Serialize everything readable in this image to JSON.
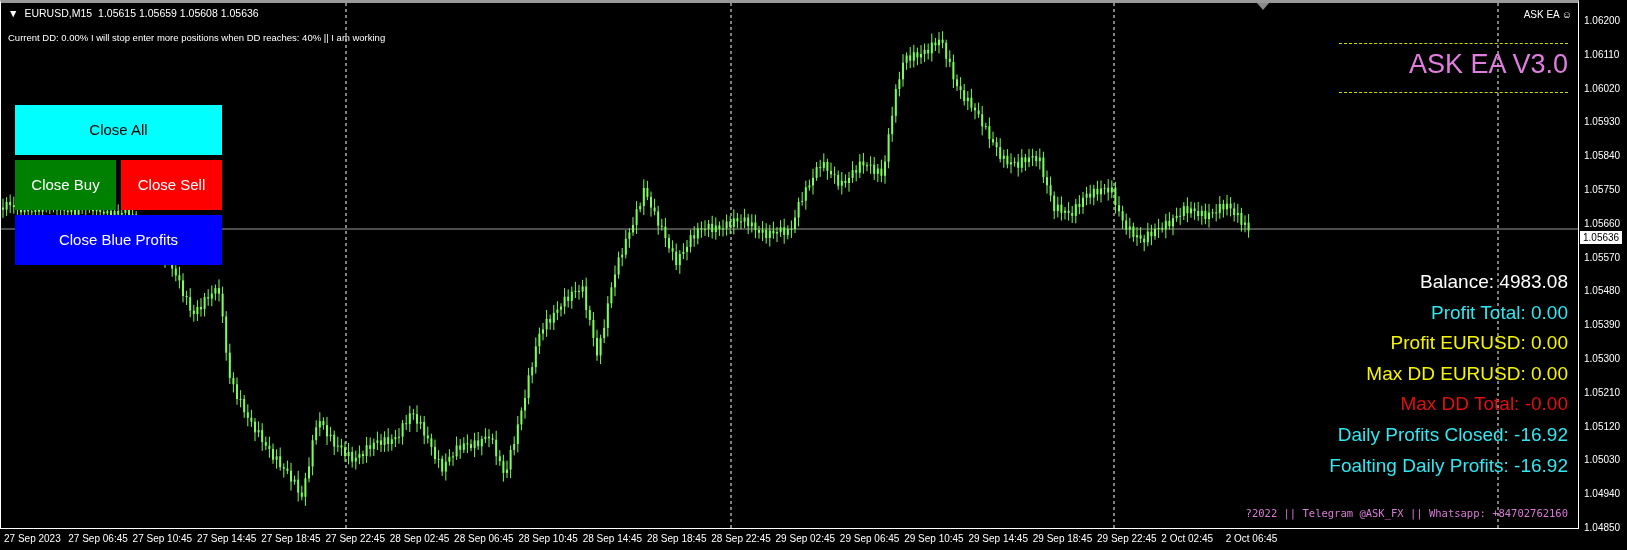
{
  "chart_header": {
    "menu_icon": "▼",
    "title": "EURUSD,M15",
    "ohlc": "1.05615 1.05659 1.05608 1.05636"
  },
  "status_line": "Current DD: 0.00%  I will stop enter more positions when DD reaches: 40%  || I am working",
  "ea_badge": {
    "name": "ASK EA",
    "icon": "☺"
  },
  "ea_title": "ASK EA V3.0",
  "button_rows": [
    [
      {
        "label": "Close All",
        "color": "#00ffff"
      }
    ],
    [
      {
        "label": "Close Buy",
        "color": "#008000"
      },
      {
        "label": "Close Sell",
        "color": "#ff0000"
      }
    ],
    [
      {
        "label": "Close Blue Profits",
        "color": "#0000ff"
      }
    ]
  ],
  "stats": [
    {
      "text": "Balance: 4983.08",
      "color": "#ffffff"
    },
    {
      "text": "Profit Total: 0.00",
      "color": "#33e6f0"
    },
    {
      "text": "Profit EURUSD: 0.00",
      "color": "#f5f500"
    },
    {
      "text": "Max DD EURUSD: 0.00",
      "color": "#f5f500"
    },
    {
      "text": "Max DD Total: -0.00",
      "color": "#e01010"
    },
    {
      "text": "Daily Profits Closed: -16.92",
      "color": "#33e6f0"
    },
    {
      "text": "Foalting Daily Profits: -16.92",
      "color": "#33e6f0"
    }
  ],
  "footer": "?2022 || Telegram @ASK_FX || Whatsapp: +84702762160",
  "price_axis": {
    "labels": [
      "1.06200",
      "1.06110",
      "1.06020",
      "1.05930",
      "1.05840",
      "1.05750",
      "1.05660",
      "1.05570",
      "1.05480",
      "1.05390",
      "1.05300",
      "1.05210",
      "1.05120",
      "1.05030",
      "1.04940",
      "1.04850"
    ],
    "current_price": "1.05636"
  },
  "time_axis": {
    "labels": [
      "27 Sep 2023",
      "27 Sep 06:45",
      "27 Sep 10:45",
      "27 Sep 14:45",
      "27 Sep 18:45",
      "27 Sep 22:45",
      "28 Sep 02:45",
      "28 Sep 06:45",
      "28 Sep 10:45",
      "28 Sep 14:45",
      "28 Sep 18:45",
      "28 Sep 22:45",
      "29 Sep 02:45",
      "29 Sep 06:45",
      "29 Sep 10:45",
      "29 Sep 14:45",
      "29 Sep 18:45",
      "29 Sep 22:45",
      "2 Oct 02:45",
      "2 Oct 06:45"
    ]
  }
}
